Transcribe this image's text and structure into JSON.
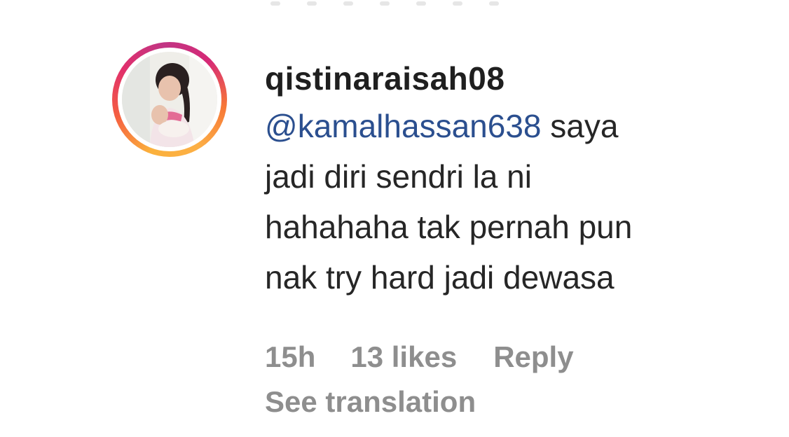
{
  "comment": {
    "username": "qistinaraisah08",
    "mention": "@kamalhassan638",
    "text_line1": " saya",
    "text_line2": "jadi diri sendri la ni",
    "text_line3": "hahahaha tak pernah pun",
    "text_line4": "nak try hard jadi dewasa",
    "time": "15h",
    "likes": "13 likes",
    "reply_label": "Reply",
    "see_translation_label": "See translation"
  },
  "colors": {
    "mention": "#2b4f8f",
    "meta": "#8e8e8e",
    "username": "#1f1f1f"
  },
  "icons": {
    "avatar": "profile-photo"
  }
}
